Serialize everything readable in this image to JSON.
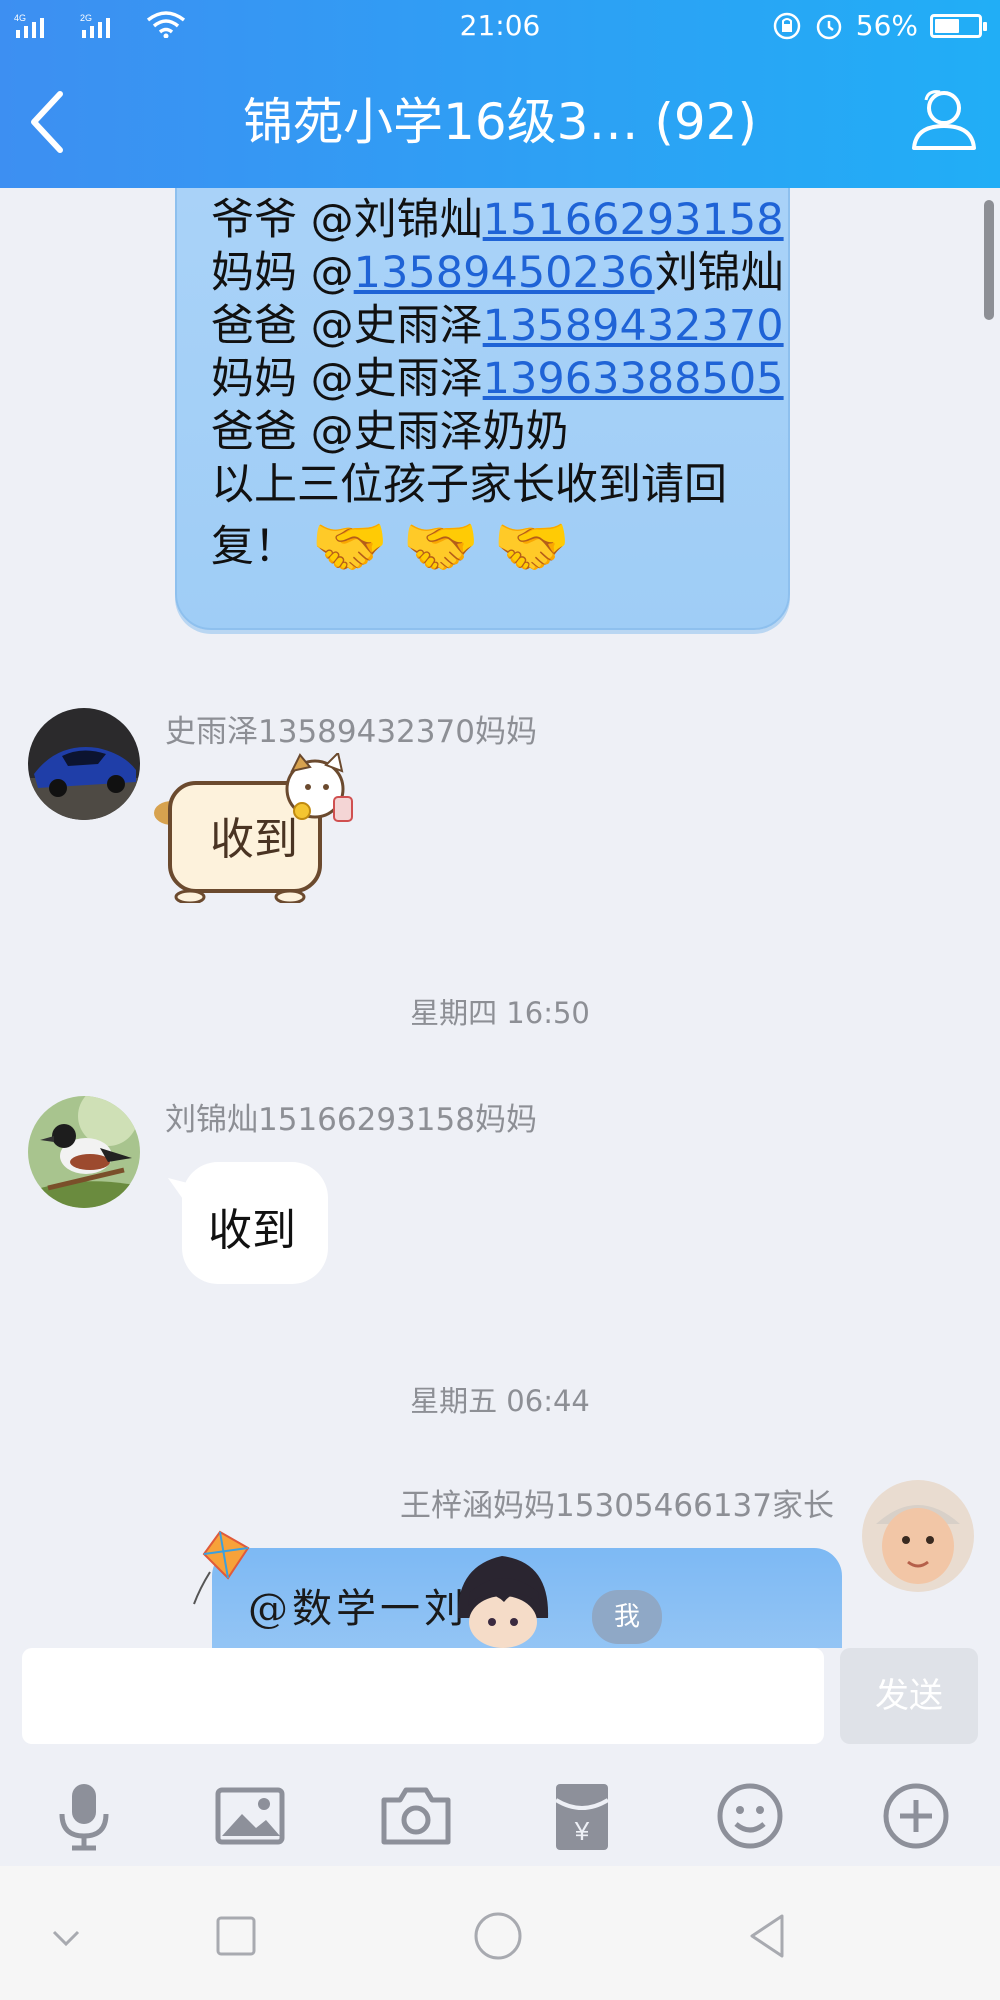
{
  "status_bar": {
    "network_1": "4G",
    "network_2": "2G",
    "time": "21:06",
    "battery_percent": "56%",
    "battery_level": 0.56
  },
  "header": {
    "title": "锦苑小学16级3… (92)",
    "back_icon": "chevron-left-icon",
    "members_icon": "person-icon"
  },
  "messages": {
    "self_bubble": {
      "lines": [
        {
          "prefix": "爷爷 @刘锦灿",
          "link": "15166293158",
          "suffix": ""
        },
        {
          "prefix": "妈妈 @",
          "link": "13589450236",
          "suffix": "刘锦灿"
        },
        {
          "prefix": "爸爸 @史雨泽",
          "link": "13589432370",
          "suffix": ""
        },
        {
          "prefix": "妈妈 @史雨泽",
          "link": "13963388505",
          "suffix": ""
        },
        {
          "prefix": "爸爸 @史雨泽奶奶",
          "link": "",
          "suffix": ""
        },
        {
          "prefix": "以上三位孩子家长收到请回",
          "link": "",
          "suffix": ""
        }
      ],
      "reply_text": "复！",
      "emojis": [
        "🤝",
        "🤝",
        "🤝"
      ]
    },
    "msg1": {
      "sender": "史雨泽13589432370妈妈",
      "sticker_text": "收到"
    },
    "timestamp1": "星期四 16:50",
    "msg2": {
      "sender": "刘锦灿15166293158妈妈",
      "text": "收到"
    },
    "timestamp2": "星期五 06:44",
    "msg3": {
      "sender": "王梓涵妈妈15305466137家长",
      "text": "@数学一刘",
      "badge": "我"
    }
  },
  "input": {
    "value": "",
    "send_label": "发送"
  },
  "toolbar_icons": [
    "microphone-icon",
    "image-icon",
    "camera-icon",
    "red-packet-icon",
    "emoji-icon",
    "plus-icon"
  ],
  "system_nav_icons": [
    "chevron-down-icon",
    "square-icon",
    "circle-icon",
    "triangle-back-icon"
  ]
}
